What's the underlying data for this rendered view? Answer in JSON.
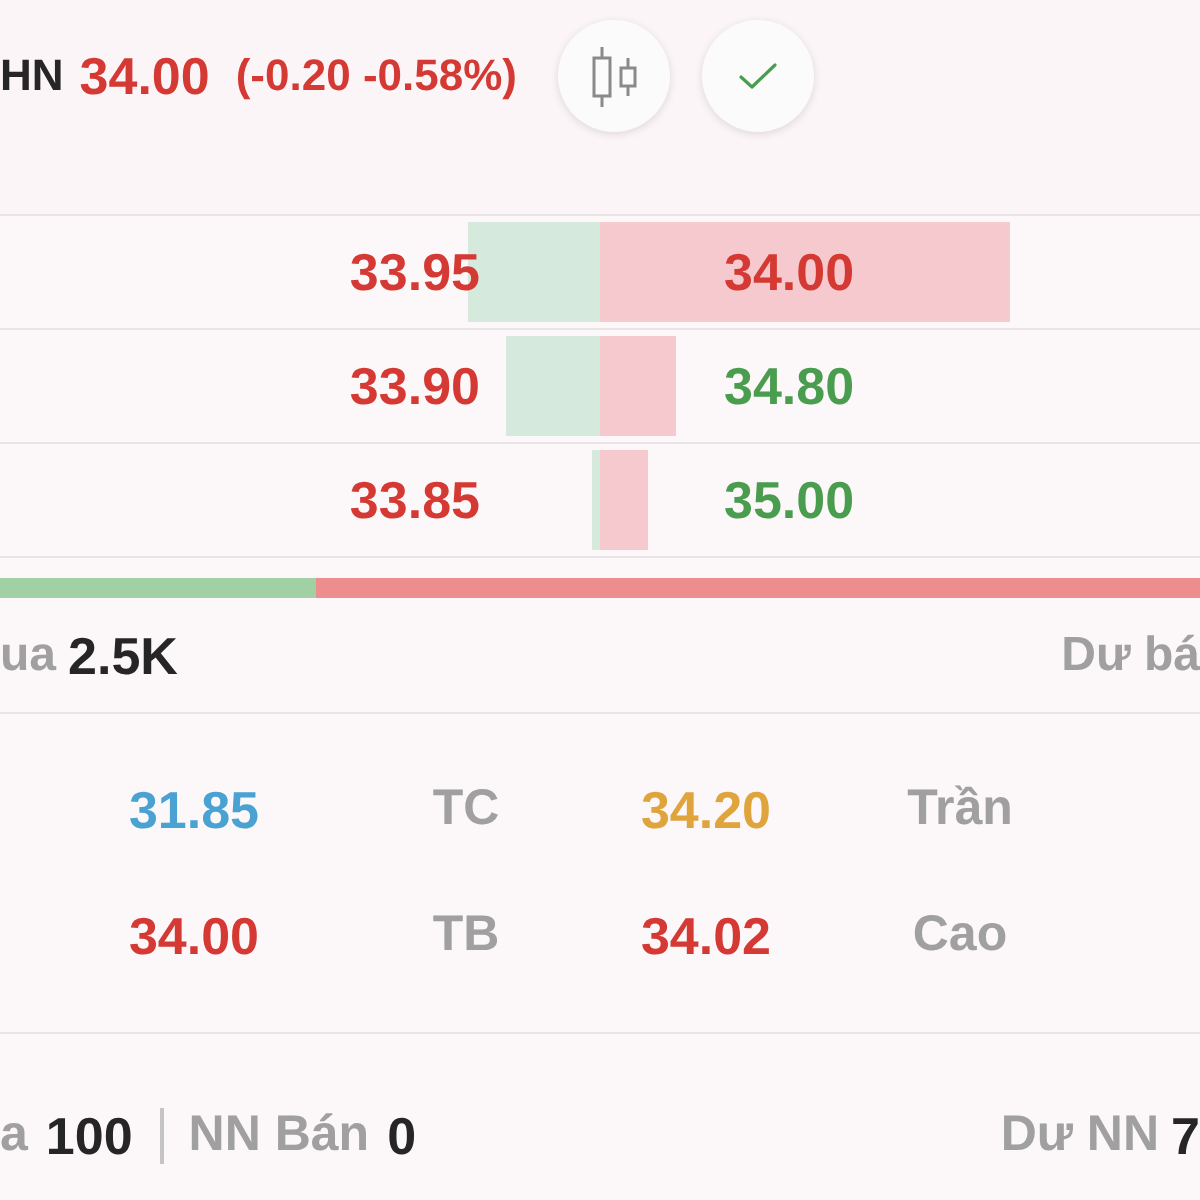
{
  "header": {
    "symbol": "HN",
    "price": "34.00",
    "change": "(-0.20 -0.58%)",
    "color": "#d43a33"
  },
  "order_book": {
    "rows": [
      {
        "bid": {
          "price": "33.95",
          "color": "#d43a33",
          "level": 0.22
        },
        "ask": {
          "price": "34.00",
          "color": "#d43a33",
          "level": 0.683
        }
      },
      {
        "bid": {
          "price": "33.90",
          "color": "#d43a33",
          "level": 0.157
        },
        "ask": {
          "price": "34.80",
          "color": "#4a9d4f",
          "level": 0.127
        }
      },
      {
        "bid": {
          "price": "33.85",
          "color": "#d43a33",
          "level": 0.013
        },
        "ask": {
          "price": "35.00",
          "color": "#4a9d4f",
          "level": 0.08
        }
      }
    ]
  },
  "ratio_bar": {
    "level": 0.263
  },
  "summary": {
    "left": {
      "label": "ua",
      "value": "2.5K"
    },
    "right": {
      "label": "Dư bá"
    }
  },
  "stats": {
    "rows": [
      {
        "cells": [
          {
            "kind": "value",
            "text": "31.85",
            "color": "#4aa2d3"
          },
          {
            "kind": "label",
            "text": "TC"
          },
          {
            "kind": "value",
            "text": "34.20",
            "color": "#e0a43c"
          },
          {
            "kind": "label",
            "text": "Trần"
          }
        ]
      },
      {
        "cells": [
          {
            "kind": "value",
            "text": "34.00",
            "color": "#d43a33"
          },
          {
            "kind": "label",
            "text": "TB"
          },
          {
            "kind": "value",
            "text": "34.02",
            "color": "#d43a33"
          },
          {
            "kind": "label",
            "text": "Cao"
          }
        ]
      }
    ]
  },
  "foreign": {
    "items": [
      {
        "label": "a",
        "value": "100"
      },
      {
        "label": "NN Bán",
        "value": "0"
      }
    ],
    "right": {
      "label": "Dư NN",
      "value": "7"
    }
  }
}
